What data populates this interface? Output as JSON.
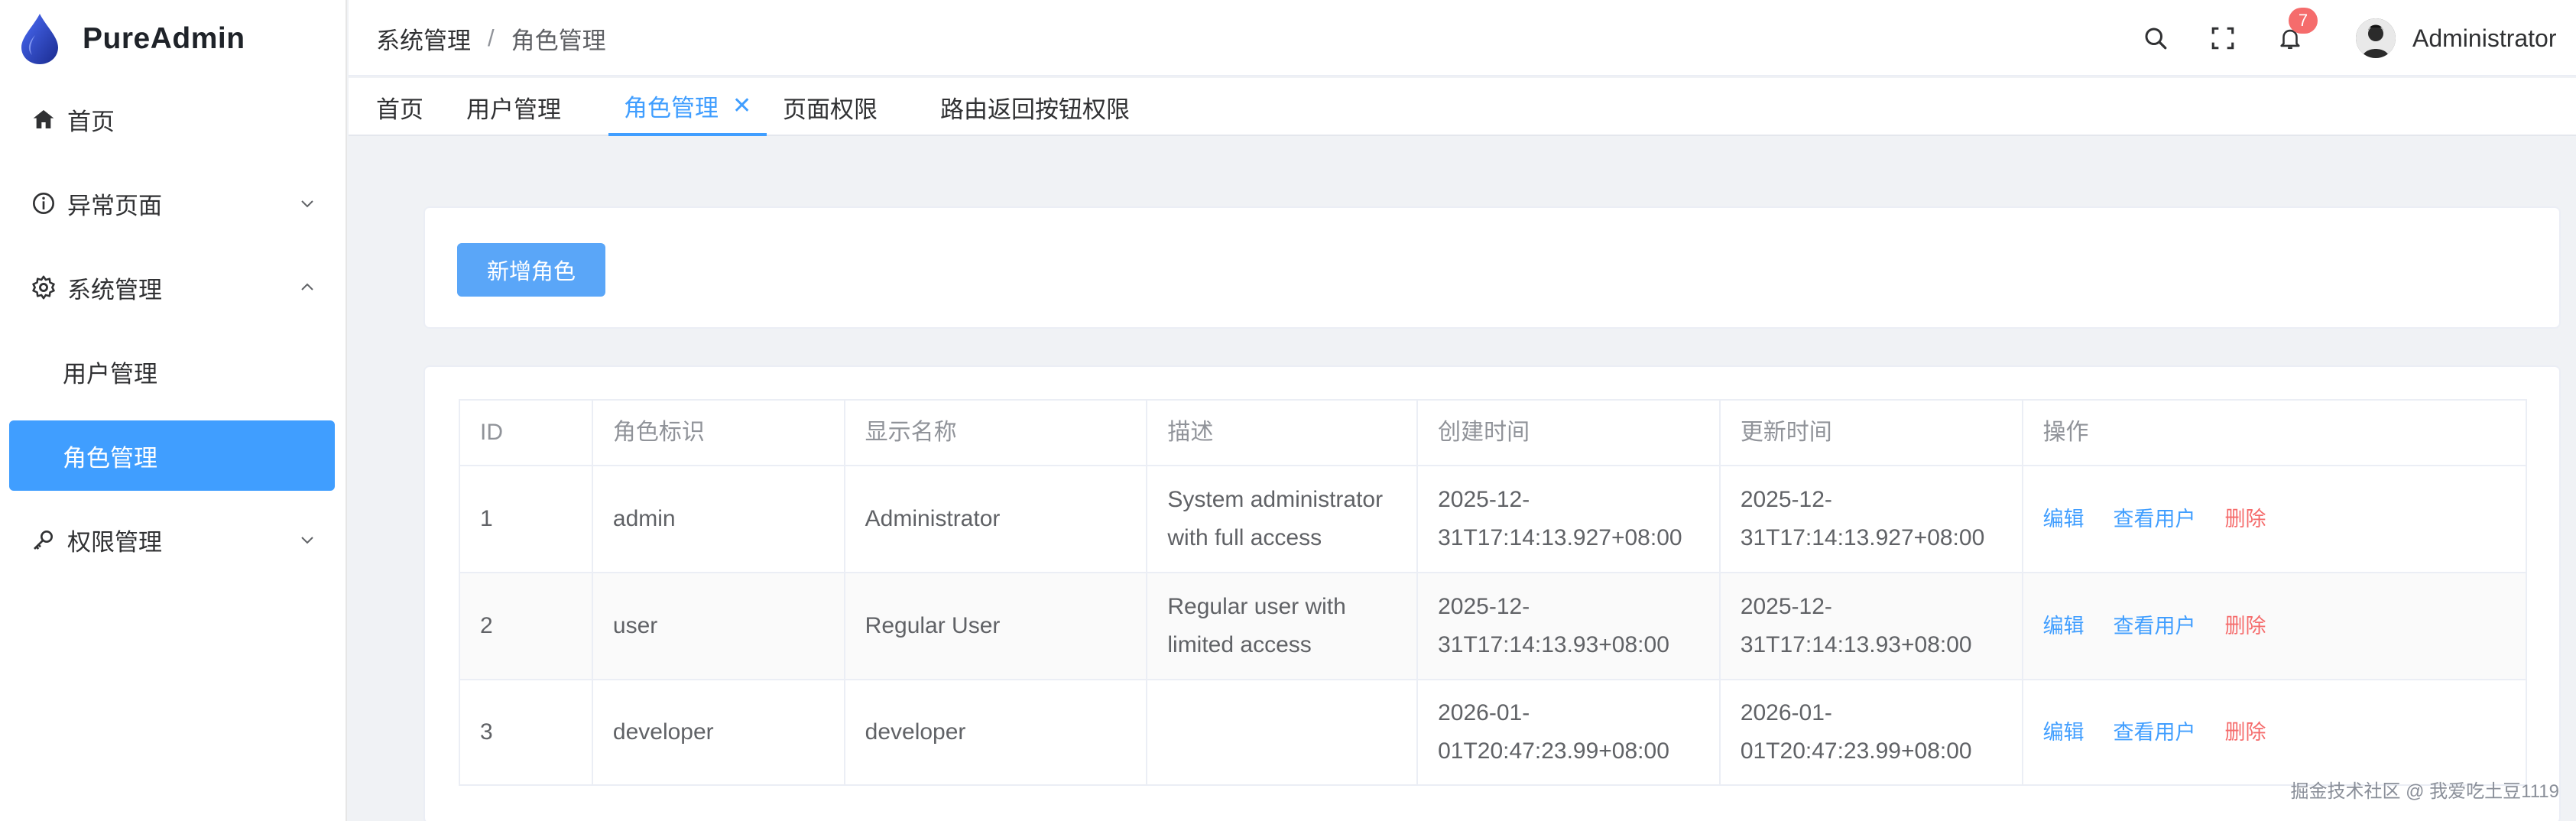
{
  "app": {
    "title": "PureAdmin"
  },
  "sidebar": {
    "items": [
      {
        "label": "首页",
        "icon": "home-icon"
      },
      {
        "label": "异常页面",
        "icon": "info-circle-icon"
      },
      {
        "label": "系统管理",
        "icon": "gear-icon"
      },
      {
        "label": "权限管理",
        "icon": "key-icon"
      }
    ],
    "sub_items": [
      {
        "label": "用户管理"
      },
      {
        "label": "角色管理",
        "active": true
      }
    ]
  },
  "header": {
    "breadcrumb": [
      "系统管理",
      "/",
      "角色管理"
    ],
    "notifications_count": "7",
    "username": "Administrator"
  },
  "tabs": [
    {
      "label": "首页"
    },
    {
      "label": "用户管理"
    },
    {
      "label": "角色管理",
      "active": true,
      "close": "✕"
    },
    {
      "label": "页面权限"
    },
    {
      "label": "路由返回按钮权限"
    }
  ],
  "toolbar": {
    "add_role_label": "新增角色"
  },
  "table": {
    "columns": [
      "ID",
      "角色标识",
      "显示名称",
      "描述",
      "创建时间",
      "更新时间",
      "操作"
    ],
    "rows": [
      {
        "id": "1",
        "key": "admin",
        "name": "Administrator",
        "desc1": "System administrator",
        "desc2": "with full access",
        "created1": "2025-12-",
        "created2": "31T17:14:13.927+08:00",
        "updated1": "2025-12-",
        "updated2": "31T17:14:13.927+08:00"
      },
      {
        "id": "2",
        "key": "user",
        "name": "Regular User",
        "desc1": "Regular user with",
        "desc2": "limited access",
        "created1": "2025-12-",
        "created2": "31T17:14:13.93+08:00",
        "updated1": "2025-12-",
        "updated2": "31T17:14:13.93+08:00"
      },
      {
        "id": "3",
        "key": "developer",
        "name": "developer",
        "desc1": "",
        "desc2": "",
        "created1": "2026-01-",
        "created2": "01T20:47:23.99+08:00",
        "updated1": "2026-01-",
        "updated2": "01T20:47:23.99+08:00"
      }
    ],
    "actions": {
      "edit": "编辑",
      "view_users": "查看用户",
      "delete": "删除"
    }
  },
  "watermark": "掘金技术社区 @ 我爱吃土豆1119",
  "colors": {
    "primary": "#409eff",
    "danger": "#f56c6c",
    "sidebar_active": "#409eff"
  }
}
